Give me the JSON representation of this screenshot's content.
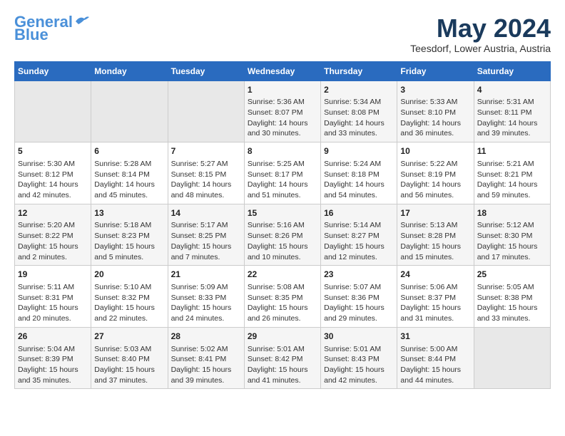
{
  "header": {
    "logo_general": "General",
    "logo_blue": "Blue",
    "month_year": "May 2024",
    "location": "Teesdorf, Lower Austria, Austria"
  },
  "weekdays": [
    "Sunday",
    "Monday",
    "Tuesday",
    "Wednesday",
    "Thursday",
    "Friday",
    "Saturday"
  ],
  "weeks": [
    [
      {
        "day": "",
        "empty": true
      },
      {
        "day": "",
        "empty": true
      },
      {
        "day": "",
        "empty": true
      },
      {
        "day": "1",
        "sunrise": "5:36 AM",
        "sunset": "8:07 PM",
        "daylight": "14 hours and 30 minutes."
      },
      {
        "day": "2",
        "sunrise": "5:34 AM",
        "sunset": "8:08 PM",
        "daylight": "14 hours and 33 minutes."
      },
      {
        "day": "3",
        "sunrise": "5:33 AM",
        "sunset": "8:10 PM",
        "daylight": "14 hours and 36 minutes."
      },
      {
        "day": "4",
        "sunrise": "5:31 AM",
        "sunset": "8:11 PM",
        "daylight": "14 hours and 39 minutes."
      }
    ],
    [
      {
        "day": "5",
        "sunrise": "5:30 AM",
        "sunset": "8:12 PM",
        "daylight": "14 hours and 42 minutes."
      },
      {
        "day": "6",
        "sunrise": "5:28 AM",
        "sunset": "8:14 PM",
        "daylight": "14 hours and 45 minutes."
      },
      {
        "day": "7",
        "sunrise": "5:27 AM",
        "sunset": "8:15 PM",
        "daylight": "14 hours and 48 minutes."
      },
      {
        "day": "8",
        "sunrise": "5:25 AM",
        "sunset": "8:17 PM",
        "daylight": "14 hours and 51 minutes."
      },
      {
        "day": "9",
        "sunrise": "5:24 AM",
        "sunset": "8:18 PM",
        "daylight": "14 hours and 54 minutes."
      },
      {
        "day": "10",
        "sunrise": "5:22 AM",
        "sunset": "8:19 PM",
        "daylight": "14 hours and 56 minutes."
      },
      {
        "day": "11",
        "sunrise": "5:21 AM",
        "sunset": "8:21 PM",
        "daylight": "14 hours and 59 minutes."
      }
    ],
    [
      {
        "day": "12",
        "sunrise": "5:20 AM",
        "sunset": "8:22 PM",
        "daylight": "15 hours and 2 minutes."
      },
      {
        "day": "13",
        "sunrise": "5:18 AM",
        "sunset": "8:23 PM",
        "daylight": "15 hours and 5 minutes."
      },
      {
        "day": "14",
        "sunrise": "5:17 AM",
        "sunset": "8:25 PM",
        "daylight": "15 hours and 7 minutes."
      },
      {
        "day": "15",
        "sunrise": "5:16 AM",
        "sunset": "8:26 PM",
        "daylight": "15 hours and 10 minutes."
      },
      {
        "day": "16",
        "sunrise": "5:14 AM",
        "sunset": "8:27 PM",
        "daylight": "15 hours and 12 minutes."
      },
      {
        "day": "17",
        "sunrise": "5:13 AM",
        "sunset": "8:28 PM",
        "daylight": "15 hours and 15 minutes."
      },
      {
        "day": "18",
        "sunrise": "5:12 AM",
        "sunset": "8:30 PM",
        "daylight": "15 hours and 17 minutes."
      }
    ],
    [
      {
        "day": "19",
        "sunrise": "5:11 AM",
        "sunset": "8:31 PM",
        "daylight": "15 hours and 20 minutes."
      },
      {
        "day": "20",
        "sunrise": "5:10 AM",
        "sunset": "8:32 PM",
        "daylight": "15 hours and 22 minutes."
      },
      {
        "day": "21",
        "sunrise": "5:09 AM",
        "sunset": "8:33 PM",
        "daylight": "15 hours and 24 minutes."
      },
      {
        "day": "22",
        "sunrise": "5:08 AM",
        "sunset": "8:35 PM",
        "daylight": "15 hours and 26 minutes."
      },
      {
        "day": "23",
        "sunrise": "5:07 AM",
        "sunset": "8:36 PM",
        "daylight": "15 hours and 29 minutes."
      },
      {
        "day": "24",
        "sunrise": "5:06 AM",
        "sunset": "8:37 PM",
        "daylight": "15 hours and 31 minutes."
      },
      {
        "day": "25",
        "sunrise": "5:05 AM",
        "sunset": "8:38 PM",
        "daylight": "15 hours and 33 minutes."
      }
    ],
    [
      {
        "day": "26",
        "sunrise": "5:04 AM",
        "sunset": "8:39 PM",
        "daylight": "15 hours and 35 minutes."
      },
      {
        "day": "27",
        "sunrise": "5:03 AM",
        "sunset": "8:40 PM",
        "daylight": "15 hours and 37 minutes."
      },
      {
        "day": "28",
        "sunrise": "5:02 AM",
        "sunset": "8:41 PM",
        "daylight": "15 hours and 39 minutes."
      },
      {
        "day": "29",
        "sunrise": "5:01 AM",
        "sunset": "8:42 PM",
        "daylight": "15 hours and 41 minutes."
      },
      {
        "day": "30",
        "sunrise": "5:01 AM",
        "sunset": "8:43 PM",
        "daylight": "15 hours and 42 minutes."
      },
      {
        "day": "31",
        "sunrise": "5:00 AM",
        "sunset": "8:44 PM",
        "daylight": "15 hours and 44 minutes."
      },
      {
        "day": "",
        "empty": true
      }
    ]
  ],
  "labels": {
    "sunrise": "Sunrise: ",
    "sunset": "Sunset: ",
    "daylight": "Daylight: "
  }
}
